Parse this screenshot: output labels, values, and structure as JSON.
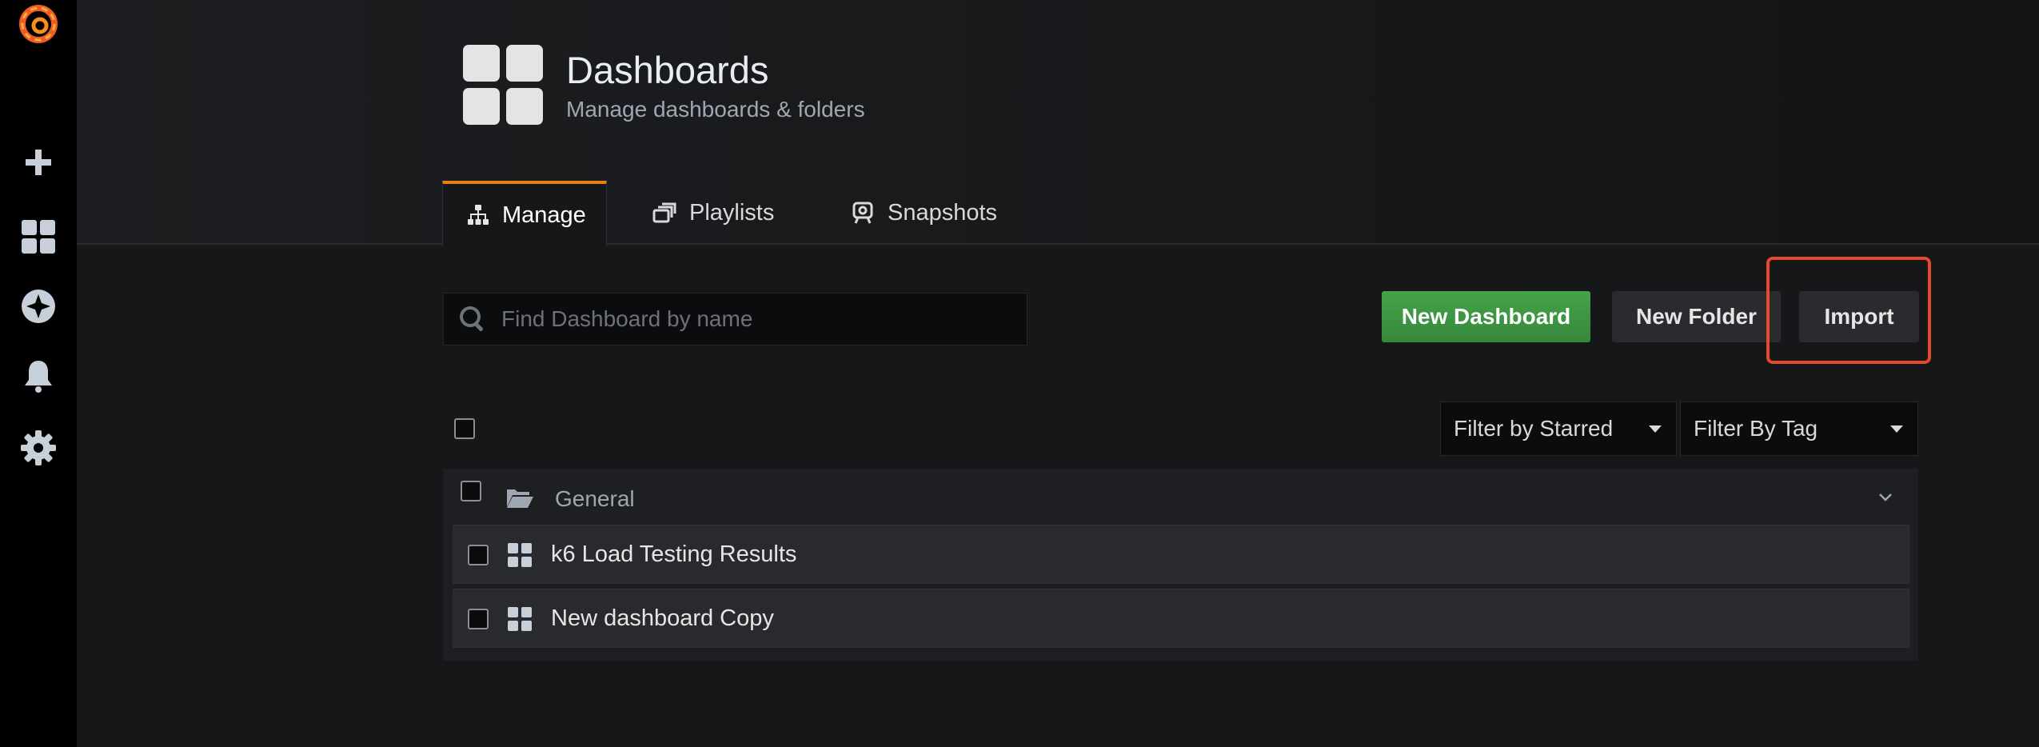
{
  "sidemenu": {
    "items": [
      {
        "icon": "grafana-logo-icon"
      },
      {
        "icon": "plus-icon"
      },
      {
        "icon": "dashboards-icon"
      },
      {
        "icon": "explore-icon"
      },
      {
        "icon": "alert-bell-icon"
      },
      {
        "icon": "gear-icon"
      }
    ]
  },
  "header": {
    "title": "Dashboards",
    "subtitle": "Manage dashboards & folders",
    "tabs": [
      {
        "label": "Manage",
        "icon": "sitemap-icon",
        "active": true
      },
      {
        "label": "Playlists",
        "icon": "playlist-icon",
        "active": false
      },
      {
        "label": "Snapshots",
        "icon": "snapshot-icon",
        "active": false
      }
    ]
  },
  "toolbar": {
    "search_placeholder": "Find Dashboard by name",
    "new_dashboard_label": "New Dashboard",
    "new_folder_label": "New Folder",
    "import_label": "Import"
  },
  "filters": {
    "starred_label": "Filter by Starred",
    "tag_label": "Filter By Tag"
  },
  "folder": {
    "name": "General",
    "dashboards": [
      {
        "title": "k6 Load Testing Results"
      },
      {
        "title": "New dashboard Copy"
      }
    ]
  },
  "colors": {
    "accent": "#eb7b18",
    "primary_button": "#3d9a42",
    "highlight": "#e8482b"
  }
}
